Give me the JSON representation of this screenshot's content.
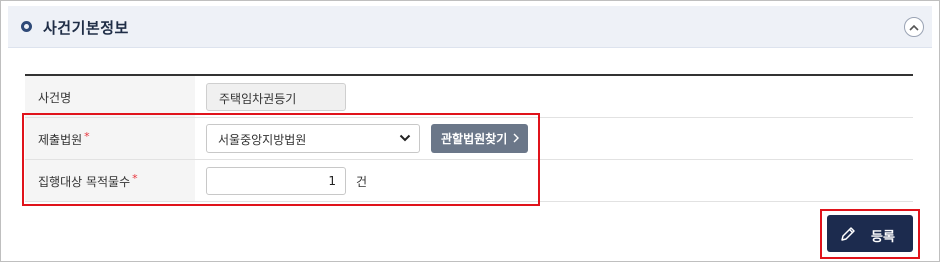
{
  "section": {
    "title": "사건기본정보"
  },
  "form": {
    "case_name": {
      "label": "사건명",
      "value": "주택임차권등기"
    },
    "court": {
      "label": "제출법원",
      "required_mark": "*",
      "selected": "서울중앙지방법원",
      "find_button": "관할법원찾기"
    },
    "object_count": {
      "label": "집행대상 목적물수",
      "required_mark": "*",
      "value": "1",
      "unit": "건"
    }
  },
  "actions": {
    "register_label": "등록"
  },
  "colors": {
    "header_bg": "#eef1f7",
    "accent_navy": "#1c2b4e",
    "button_gray": "#6b7789",
    "required_red": "#e8343c",
    "highlight_red": "#e0131b"
  },
  "icons": {
    "header": "ring-dot-icon",
    "collapse": "chevron-up-icon",
    "select": "chevron-down-icon",
    "find": "chevron-right-icon",
    "register": "pencil-icon"
  }
}
